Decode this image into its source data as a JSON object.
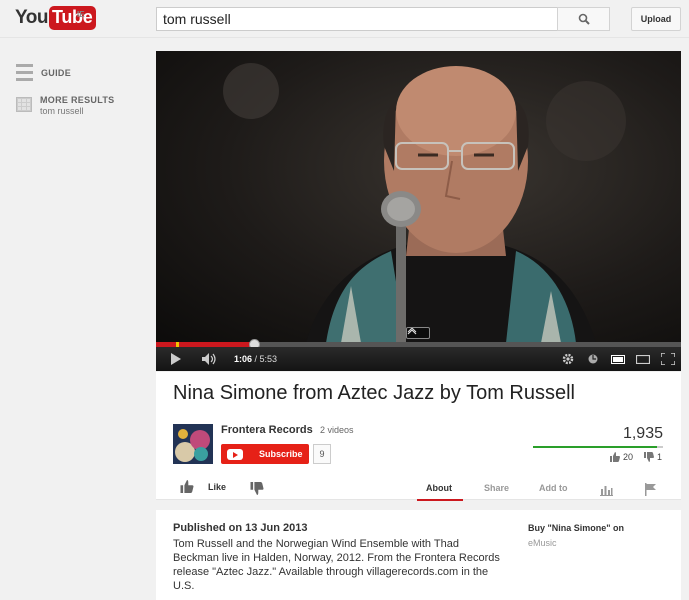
{
  "masthead": {
    "logo_you": "You",
    "logo_tube": "Tube",
    "logo_region": "IE",
    "search_value": "tom russell",
    "upload_label": "Upload"
  },
  "sidebar": {
    "guide_label": "GUIDE",
    "more_results_title": "MORE RESULTS",
    "more_results_sub": "tom russell"
  },
  "player": {
    "current_time": "1:06",
    "duration": "5:53",
    "progress_fraction": 0.187,
    "buffered_fraction": 0.187
  },
  "video": {
    "title": "Nina Simone from Aztec Jazz by Tom Russell",
    "channel_name": "Frontera Records",
    "videos_count": "2 videos",
    "subscribe_label": "Subscribe",
    "subscriber_count": "9",
    "views": "1,935",
    "likes": "20",
    "dislikes": "1",
    "like_ratio": 0.952
  },
  "actions": {
    "like_label": "Like",
    "tabs": [
      {
        "label": "About",
        "active": true
      },
      {
        "label": "Share",
        "active": false
      },
      {
        "label": "Add to",
        "active": false
      }
    ]
  },
  "description": {
    "published": "Published on 13 Jun 2013",
    "text": "Tom Russell and the Norwegian Wind Ensemble with Thad Beckman live in Halden, Norway, 2012. From the Frontera Records release \"Aztec Jazz.\" Available through villagerecords.com in the U.S.",
    "buy_label": "Buy \"Nina Simone\" on",
    "buy_source": "eMusic"
  },
  "colors": {
    "brand_red": "#cc181e",
    "subscribe_red": "#e62117",
    "like_green": "#2a9f2a"
  },
  "icons": [
    "search-icon",
    "guide-icon",
    "more-results-icon",
    "play-icon",
    "volume-icon",
    "settings-icon",
    "annotations-icon",
    "small-player-icon",
    "large-player-icon",
    "fullscreen-icon",
    "thumbs-up-icon",
    "thumbs-down-icon",
    "stats-icon",
    "flag-icon"
  ]
}
